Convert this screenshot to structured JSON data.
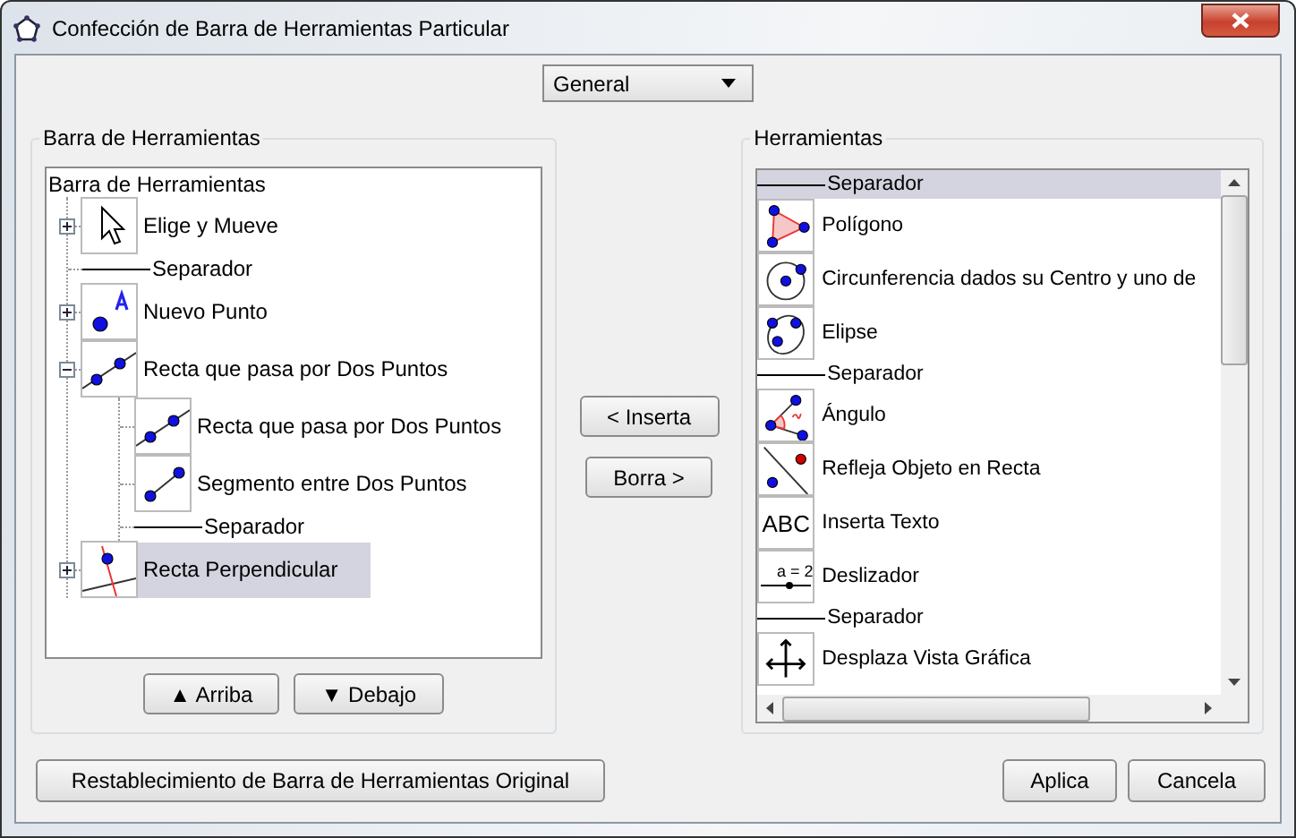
{
  "window": {
    "title": "Confección de Barra de Herramientas Particular"
  },
  "perspective": {
    "value": "General"
  },
  "toolbar_panel": {
    "title": "Barra de Herramientas",
    "tree": {
      "label": "Barra de Herramientas",
      "children": [
        {
          "kind": "tool",
          "label": "Elige y Mueve",
          "expanded": false,
          "selected": false
        },
        {
          "kind": "separator",
          "label": "Separador",
          "selected": false
        },
        {
          "kind": "tool",
          "label": "Nuevo Punto",
          "expanded": false,
          "selected": false
        },
        {
          "kind": "tool",
          "label": "Recta que pasa por Dos Puntos",
          "expanded": true,
          "selected": false,
          "children": [
            {
              "kind": "tool",
              "label": "Recta que pasa por Dos Puntos",
              "selected": false
            },
            {
              "kind": "tool",
              "label": "Segmento entre Dos Puntos",
              "selected": false
            },
            {
              "kind": "separator",
              "label": "Separador",
              "selected": false
            }
          ]
        },
        {
          "kind": "tool",
          "label": "Recta Perpendicular",
          "expanded": false,
          "selected": true
        }
      ]
    },
    "buttons": [
      "▲ Arriba",
      "▼ Debajo"
    ]
  },
  "transfer_buttons": [
    "< Inserta",
    "Borra >"
  ],
  "tools_panel": {
    "title": "Herramientas",
    "items": [
      {
        "kind": "separator",
        "label": "Separador",
        "selected": true
      },
      {
        "kind": "tool",
        "label": "Polígono",
        "selected": false
      },
      {
        "kind": "tool",
        "label": "Circunferencia dados su Centro y uno de",
        "selected": false
      },
      {
        "kind": "tool",
        "label": "Elipse",
        "selected": false
      },
      {
        "kind": "separator",
        "label": "Separador",
        "selected": false
      },
      {
        "kind": "tool",
        "label": "Ángulo",
        "selected": false
      },
      {
        "kind": "tool",
        "label": "Refleja Objeto en Recta",
        "selected": false
      },
      {
        "kind": "tool",
        "label": "Inserta Texto",
        "icon_text": "ABC",
        "selected": false
      },
      {
        "kind": "tool",
        "label": "Deslizador",
        "icon_text": "a = 2",
        "selected": false
      },
      {
        "kind": "separator",
        "label": "Separador",
        "selected": false
      },
      {
        "kind": "tool",
        "label": "Desplaza Vista Gráfica",
        "selected": false
      }
    ]
  },
  "footer": {
    "reset_button": "Restablecimiento de Barra de Herramientas Original",
    "buttons": [
      "Aplica",
      "Cancela"
    ]
  }
}
